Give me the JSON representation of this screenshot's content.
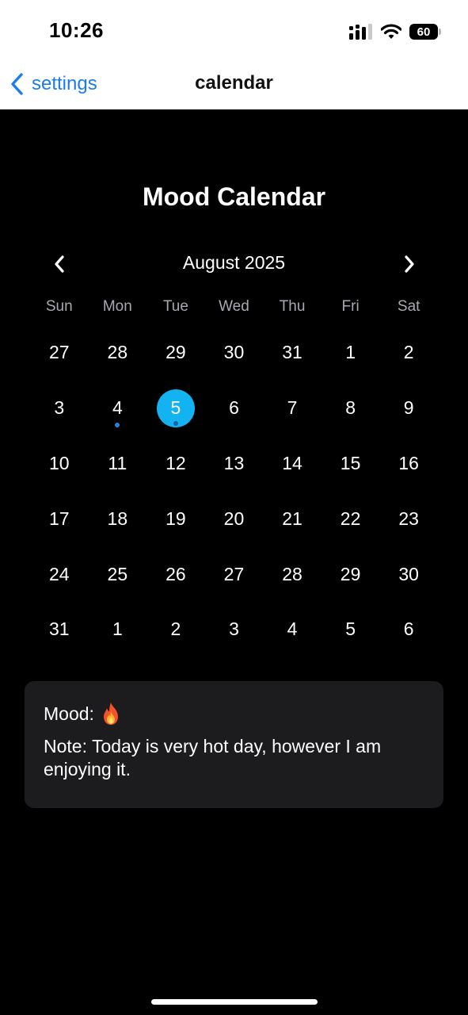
{
  "status_bar": {
    "time": "10:26",
    "battery": "60"
  },
  "nav": {
    "back_label": "settings",
    "title": "calendar"
  },
  "page": {
    "title": "Mood Calendar"
  },
  "calendar": {
    "month_label": "August 2025",
    "weekdays": [
      "Sun",
      "Mon",
      "Tue",
      "Wed",
      "Thu",
      "Fri",
      "Sat"
    ],
    "weeks": [
      [
        "27",
        "28",
        "29",
        "30",
        "31",
        "1",
        "2"
      ],
      [
        "3",
        "4",
        "5",
        "6",
        "7",
        "8",
        "9"
      ],
      [
        "10",
        "11",
        "12",
        "13",
        "14",
        "15",
        "16"
      ],
      [
        "17",
        "18",
        "19",
        "20",
        "21",
        "22",
        "23"
      ],
      [
        "24",
        "25",
        "26",
        "27",
        "28",
        "29",
        "30"
      ],
      [
        "31",
        "1",
        "2",
        "3",
        "4",
        "5",
        "6"
      ]
    ],
    "selected_day": "5",
    "days_with_entries": [
      "4",
      "5"
    ],
    "selected_color": "#12b3f0",
    "entry_dot_color": "#2f7de0"
  },
  "mood_card": {
    "mood_label": "Mood:",
    "mood_icon": "fire-emoji",
    "note": "Note: Today is very hot day, however I am enjoying it."
  },
  "colors": {
    "accent": "#1a7cf2",
    "card_bg": "#1c1c1e"
  }
}
